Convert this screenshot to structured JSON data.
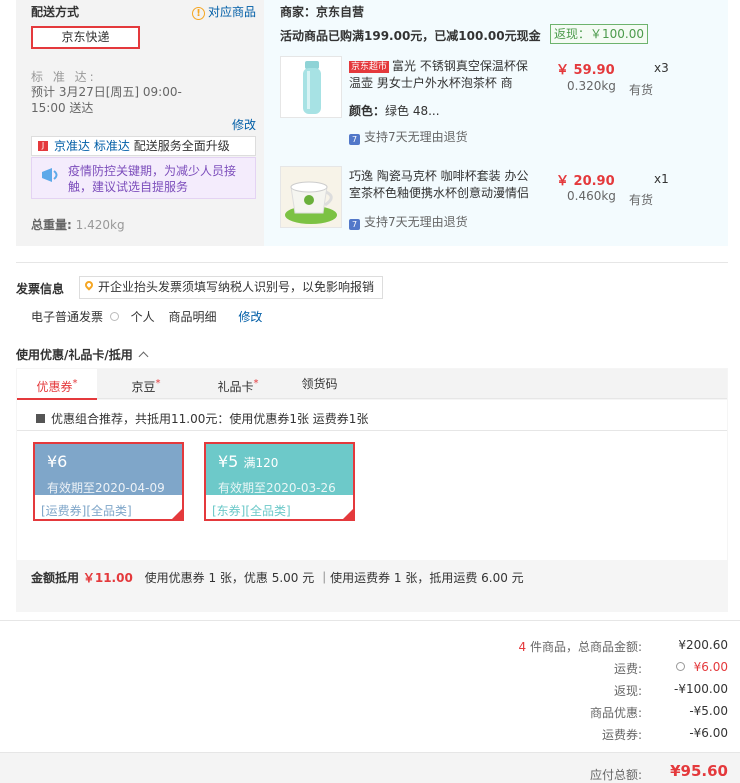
{
  "shipping": {
    "title": "配送方式",
    "match_link": "对应商品",
    "method": "京东快递",
    "time_label": "标 准 达:",
    "time_value": "预计 3月27日[周五] 09:00-15:00 送达",
    "edit": "修改",
    "jzd_link1": "京准达",
    "jzd_link2": "标准达",
    "jzd_text": "配送服务全面升级",
    "notice": "疫情防控关键期，为减少人员接触，建议试选自提服务",
    "weight_label": "总重量:",
    "weight_value": "1.420kg"
  },
  "merchant": {
    "label": "商家：京东自营",
    "promo": "活动商品已购满199.00元，已减100.00元现金",
    "rebate": "返现：￥100.00"
  },
  "items": [
    {
      "badge": "京东超市",
      "name": "富光 不锈钢真空保温杯保温壶 男女士户外水杯泡茶杯 商",
      "color_label": "颜色：",
      "color_value": "绿色 48...",
      "price": "￥ 59.90",
      "qty": "x3",
      "weight": "0.320kg",
      "stock": "有货",
      "support": "支持7天无理由退货"
    },
    {
      "badge": "",
      "name": "巧逸 陶瓷马克杯 咖啡杯套装 办公室茶杯色釉便携水杯创意动漫情侣",
      "color_label": "",
      "color_value": "",
      "price": "￥ 20.90",
      "qty": "x1",
      "weight": "0.460kg",
      "stock": "有货",
      "support": "支持7天无理由退货"
    }
  ],
  "invoice": {
    "title": "发票信息",
    "tip": "开企业抬头发票须填写纳税人识别号，以免影响报销",
    "type": "电子普通发票",
    "person": "个人",
    "content": "商品明细",
    "edit": "修改"
  },
  "coupon": {
    "title": "使用优惠/礼品卡/抵用",
    "tabs": [
      "优惠券",
      "京豆",
      "礼品卡",
      "领货码"
    ],
    "combo": "优惠组合推荐，共抵用11.00元：使用优惠券1张 运费券1张",
    "cards": [
      {
        "amount": "¥6",
        "condition": "",
        "valid": "有效期至2020-04-09",
        "tag1": "[运费券]",
        "tag2": "[全品类]",
        "color": "#7fa6c9"
      },
      {
        "amount": "¥5",
        "condition": "满120",
        "valid": "有效期至2020-03-26",
        "tag1": "[东券]",
        "tag2": "[全品类]",
        "color": "#6dc9c9"
      }
    ],
    "total_label": "金额抵用",
    "total_value": "￥11.00",
    "total_detail": "使用优惠券 1 张，优惠 5.00 元 ｜使用运费券 1 张，抵用运费 6.00 元"
  },
  "summary": {
    "count": "4",
    "count_text": "件商品，总商品金额:",
    "goods_total": "¥200.60",
    "freight_label": "运费:",
    "freight_value": "¥6.00",
    "rebate_label": "返现:",
    "rebate_value": "-¥100.00",
    "discount_label": "商品优惠:",
    "discount_value": "-¥5.00",
    "freight_cp_label": "运费券:",
    "freight_cp_value": "-¥6.00",
    "pay_label": "应付总额:",
    "pay_value": "¥95.60"
  }
}
